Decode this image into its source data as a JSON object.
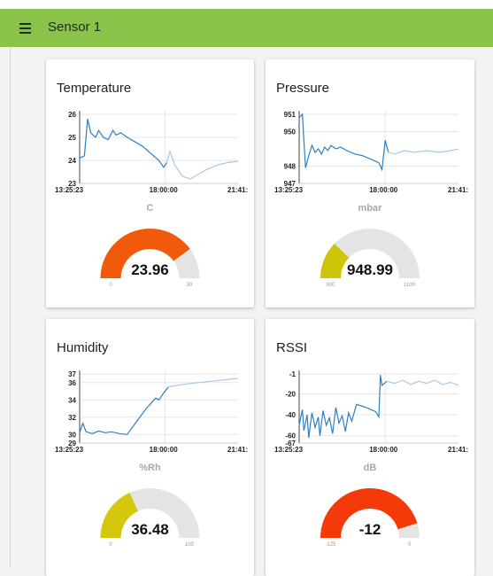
{
  "header": {
    "title": "Sensor 1",
    "menu_icon": "hamburger-menu-icon",
    "color": "#8bc34a"
  },
  "cards": [
    {
      "title": "Temperature",
      "unit": "C",
      "value": 23.96,
      "value_label": "23.96",
      "min_label": "0",
      "max_label": "30",
      "min": 0,
      "max": 30,
      "gauge_color": "#f05a0a",
      "chart_data": {
        "type": "line",
        "y_ticks": [
          "26",
          "25",
          "24",
          "23"
        ],
        "ylim": [
          23,
          26
        ],
        "x_ticks": [
          "13:25:23",
          "18:00:00",
          "21:41:"
        ],
        "series": [
          {
            "values": [
              [
                0,
                24.1
              ],
              [
                0.03,
                24.2
              ],
              [
                0.05,
                25.8
              ],
              [
                0.07,
                25.2
              ],
              [
                0.1,
                25.0
              ],
              [
                0.12,
                25.3
              ],
              [
                0.15,
                25.0
              ],
              [
                0.18,
                24.9
              ],
              [
                0.21,
                25.3
              ],
              [
                0.23,
                25.1
              ],
              [
                0.26,
                25.2
              ],
              [
                0.3,
                25.0
              ],
              [
                0.35,
                24.8
              ],
              [
                0.4,
                24.6
              ],
              [
                0.45,
                24.3
              ],
              [
                0.5,
                24.0
              ],
              [
                0.53,
                23.7
              ],
              [
                0.55,
                23.9
              ],
              [
                0.57,
                24.4
              ],
              [
                0.6,
                23.8
              ],
              [
                0.65,
                23.3
              ],
              [
                0.7,
                23.2
              ],
              [
                0.75,
                23.4
              ],
              [
                0.8,
                23.6
              ],
              [
                0.87,
                23.8
              ],
              [
                0.93,
                23.9
              ],
              [
                1,
                23.96
              ]
            ]
          }
        ]
      }
    },
    {
      "title": "Pressure",
      "unit": "mbar",
      "value": 948.99,
      "value_label": "948.99",
      "min_label": "900",
      "max_label": "1100",
      "min": 900,
      "max": 1100,
      "gauge_color": "#cdc50a",
      "chart_data": {
        "type": "line",
        "y_ticks": [
          "951",
          "950",
          "948",
          "947"
        ],
        "ylim": [
          947,
          951
        ],
        "x_ticks": [
          "13:25:23",
          "18:00:00",
          "21:41:"
        ],
        "series": [
          {
            "values": [
              [
                0,
                950.8
              ],
              [
                0.02,
                951.0
              ],
              [
                0.04,
                947.9
              ],
              [
                0.06,
                948.6
              ],
              [
                0.08,
                949.2
              ],
              [
                0.1,
                948.8
              ],
              [
                0.12,
                949.0
              ],
              [
                0.14,
                948.7
              ],
              [
                0.16,
                949.1
              ],
              [
                0.18,
                948.9
              ],
              [
                0.2,
                949.2
              ],
              [
                0.23,
                949.0
              ],
              [
                0.26,
                949.1
              ],
              [
                0.3,
                948.9
              ],
              [
                0.35,
                948.7
              ],
              [
                0.4,
                948.6
              ],
              [
                0.45,
                948.4
              ],
              [
                0.5,
                948.2
              ],
              [
                0.52,
                947.8
              ],
              [
                0.54,
                949.5
              ],
              [
                0.56,
                948.8
              ],
              [
                0.6,
                948.7
              ],
              [
                0.66,
                948.9
              ],
              [
                0.72,
                948.8
              ],
              [
                0.8,
                948.9
              ],
              [
                0.88,
                948.8
              ],
              [
                0.95,
                948.9
              ],
              [
                1,
                948.99
              ]
            ]
          }
        ]
      }
    },
    {
      "title": "Humidity",
      "unit": "%Rh",
      "value": 36.48,
      "value_label": "36.48",
      "min_label": "0",
      "max_label": "100",
      "min": 0,
      "max": 100,
      "gauge_color": "#d5c80c",
      "chart_data": {
        "type": "line",
        "y_ticks": [
          "37",
          "36",
          "34",
          "32",
          "30",
          "29"
        ],
        "ylim": [
          29,
          37
        ],
        "x_ticks": [
          "13:25:23",
          "18:00:00",
          "21:41:"
        ],
        "series": [
          {
            "values": [
              [
                0,
                30.2
              ],
              [
                0.02,
                31.3
              ],
              [
                0.04,
                30.3
              ],
              [
                0.08,
                30.1
              ],
              [
                0.12,
                30.4
              ],
              [
                0.16,
                30.2
              ],
              [
                0.2,
                30.3
              ],
              [
                0.25,
                30.1
              ],
              [
                0.3,
                30.0
              ],
              [
                0.36,
                31.5
              ],
              [
                0.42,
                33.0
              ],
              [
                0.48,
                34.2
              ],
              [
                0.5,
                34.0
              ],
              [
                0.53,
                34.8
              ],
              [
                0.56,
                35.5
              ],
              [
                0.62,
                35.7
              ],
              [
                0.7,
                35.9
              ],
              [
                0.8,
                36.1
              ],
              [
                0.9,
                36.3
              ],
              [
                1,
                36.48
              ]
            ]
          }
        ]
      }
    },
    {
      "title": "RSSI",
      "unit": "dB",
      "value": -12,
      "value_label": "-12",
      "min_label": "-125",
      "max_label": "0",
      "min": -125,
      "max": 0,
      "gauge_color": "#f53a0a",
      "chart_data": {
        "type": "line",
        "y_ticks": [
          "-1",
          "-20",
          "-40",
          "-60",
          "-67"
        ],
        "ylim": [
          -67,
          -1
        ],
        "x_ticks": [
          "13:25:23",
          "18:00:00",
          "21:41:"
        ],
        "series": [
          {
            "values": [
              [
                0,
                -50
              ],
              [
                0.02,
                -35
              ],
              [
                0.03,
                -55
              ],
              [
                0.05,
                -40
              ],
              [
                0.06,
                -62
              ],
              [
                0.08,
                -38
              ],
              [
                0.1,
                -52
              ],
              [
                0.12,
                -42
              ],
              [
                0.13,
                -60
              ],
              [
                0.15,
                -36
              ],
              [
                0.17,
                -50
              ],
              [
                0.19,
                -43
              ],
              [
                0.21,
                -58
              ],
              [
                0.23,
                -33
              ],
              [
                0.25,
                -48
              ],
              [
                0.27,
                -41
              ],
              [
                0.29,
                -56
              ],
              [
                0.31,
                -38
              ],
              [
                0.33,
                -46
              ],
              [
                0.36,
                -30
              ],
              [
                0.42,
                -33
              ],
              [
                0.48,
                -37
              ],
              [
                0.5,
                -42
              ],
              [
                0.51,
                -2
              ],
              [
                0.52,
                -12
              ],
              [
                0.55,
                -8
              ],
              [
                0.6,
                -10
              ],
              [
                0.65,
                -7
              ],
              [
                0.7,
                -11
              ],
              [
                0.75,
                -8
              ],
              [
                0.8,
                -10
              ],
              [
                0.85,
                -7
              ],
              [
                0.9,
                -11
              ],
              [
                0.95,
                -9
              ],
              [
                1,
                -12
              ]
            ]
          }
        ]
      }
    }
  ]
}
